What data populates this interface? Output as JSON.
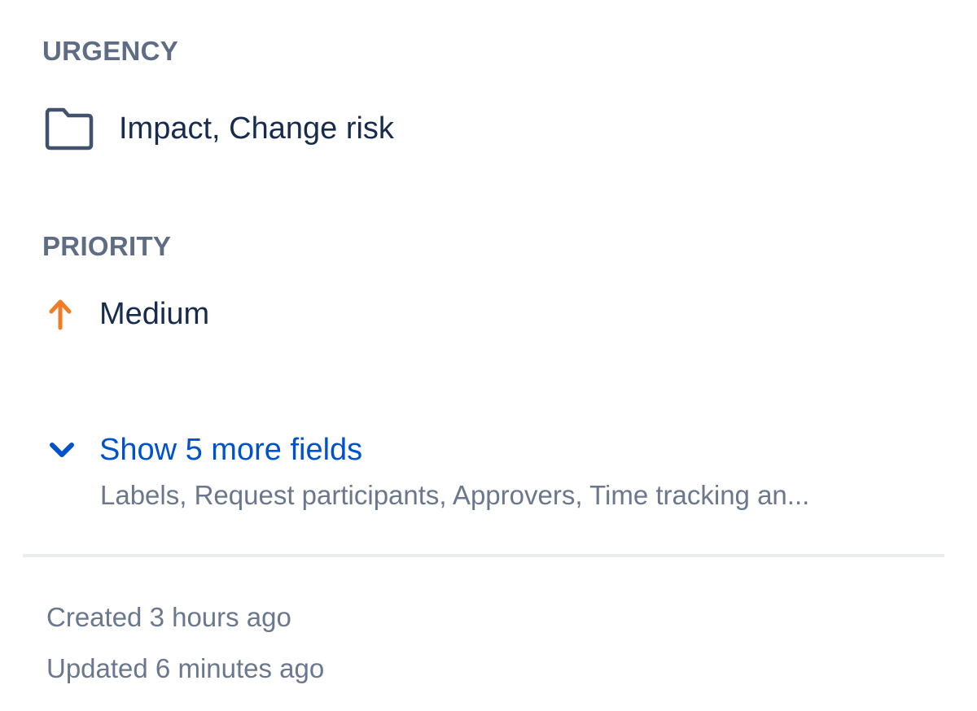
{
  "urgency": {
    "label": "URGENCY",
    "value": "Impact, Change risk",
    "icon": "folder-icon"
  },
  "priority": {
    "label": "PRIORITY",
    "value": "Medium",
    "icon": "arrow-up-icon",
    "icon_color": "#f07d26"
  },
  "more_fields": {
    "label": "Show 5 more fields",
    "fields_preview": "Labels, Request participants, Approvers, Time tracking an...",
    "icon": "chevron-down-icon",
    "link_color": "#0052cc"
  },
  "meta": {
    "created": "Created 3 hours ago",
    "updated": "Updated 6 minutes ago"
  }
}
